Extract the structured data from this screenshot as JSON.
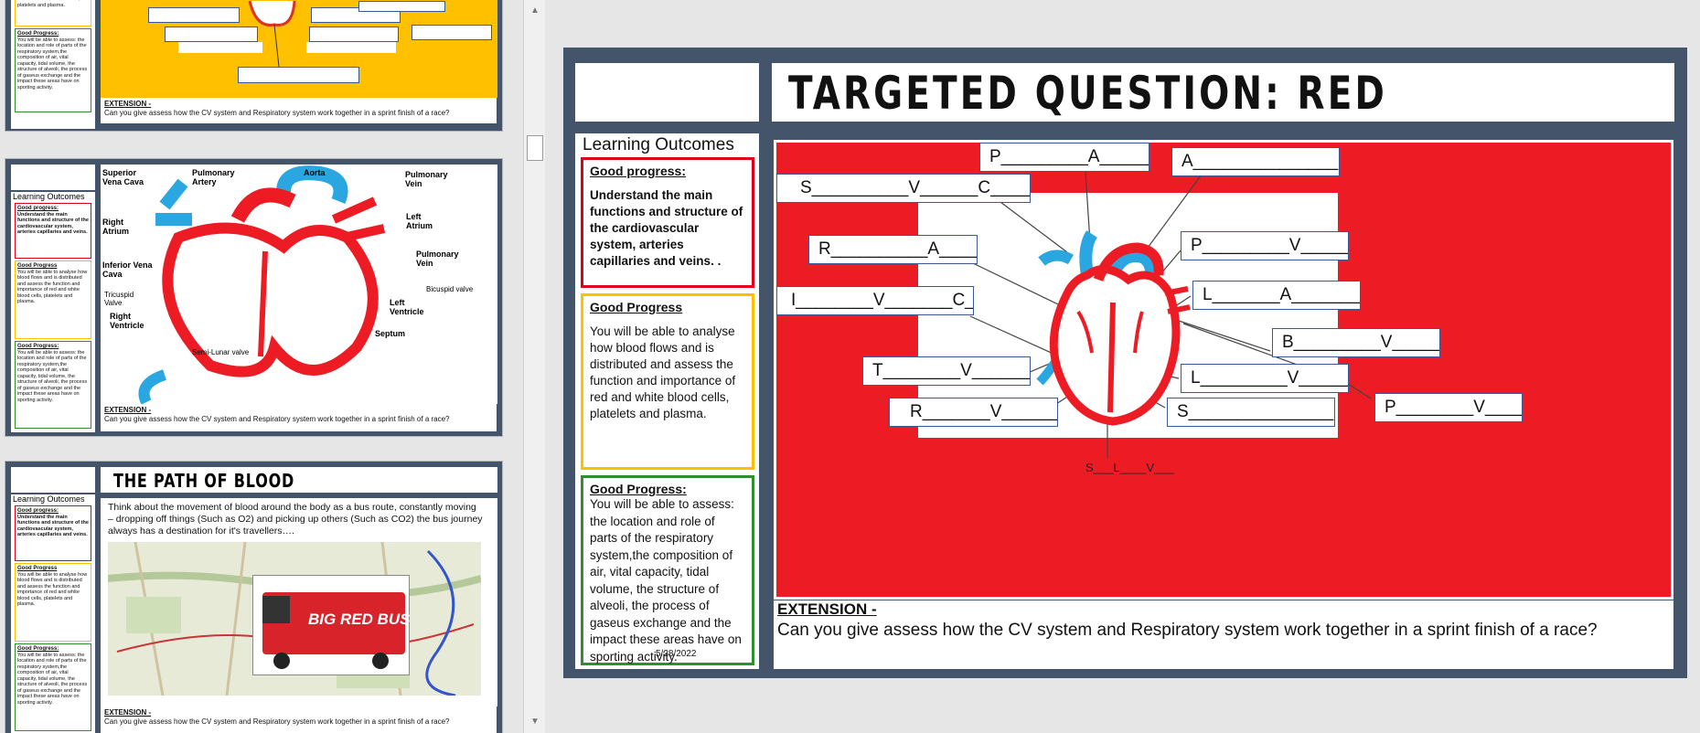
{
  "main_slide": {
    "title": "TARGETED QUESTION: RED",
    "learning_outcomes_title": "Learning Outcomes",
    "outcomes": [
      {
        "heading": "Good progress:",
        "body": "Understand the main functions and structure of the cardiovascular system, arteries capillaries and veins.  ."
      },
      {
        "heading": "Good Progress",
        "body": "You will be able to analyse how blood flows and is distributed and assess the function and importance of red and white blood cells, platelets and plasma."
      },
      {
        "heading": "Good Progress:",
        "body": "You will be able to assess: the location and role of parts of the respiratory system,the composition of air, vital capacity, tidal volume, the structure of alveoli, the process of gaseus exchange and the impact these areas have on sporting activity."
      }
    ],
    "date": "5/28/2022",
    "labels": [
      "P_________A_________",
      "A_______________",
      "S__________V______C_____",
      "R__________A_______",
      "P_________V_________",
      "I________V_______C___",
      "L_______A_________",
      "B_________V________",
      "T________V_________",
      "L_________V__________",
      "R_______V_______",
      "S_______________",
      "P________V______",
      "S___L____V___"
    ],
    "extension_label": "EXTENSION -",
    "extension_text": "Can you give assess how the CV system and Respiratory system work together in a sprint finish of a race?"
  },
  "thumbnails": [
    {
      "extension_label": "EXTENSION -",
      "extension_text": "Can you give assess how the CV system and Respiratory system work together in a sprint finish of a race?",
      "outcome_top": "of red and white blood cells, platelets and plasma.",
      "outcome_green_heading": "Good Progress:",
      "outcome_green_body": "You will be able to assess: the location and role of parts of the respiratory system,the composition of air, vital capacity, tidal volume, the structure of alveoli, the process of gaseus exchange and the impact these areas have on sporting activity."
    },
    {
      "lo_title": "Learning Outcomes",
      "heart_labels": [
        "Superior Vena Cava",
        "Pulmonary Artery",
        "Aorta",
        "Pulmonary Vein",
        "Right Atrium",
        "Left Atrium",
        "Pulmonary Vein",
        "Inferior Vena Cava",
        "Bicuspid valve",
        "Tricuspid Valve",
        "Left Ventricle",
        "Right Ventricle",
        "Septum",
        "Semi-Lunar valve"
      ],
      "extension_label": "EXTENSION -",
      "extension_text": "Can you give assess how the CV system and Respiratory system work together in a sprint finish of a race?"
    },
    {
      "title": "THE PATH OF BLOOD",
      "lo_title": "Learning Outcomes",
      "body": "Think about the movement of blood around the body as a bus route, constantly moving – dropping off things (Such as O2) and picking up others (Such as CO2) the bus journey always has a destination for it's travellers….",
      "bus_text": "BIG RED BUS",
      "extension_label": "EXTENSION -",
      "extension_text": "Can you give assess how the CV system and Respiratory system work together in a sprint finish of a race?"
    }
  ],
  "mini_outcomes": [
    {
      "heading": "Good progress:",
      "body": "Understand the main functions and structure of the cardiovascular system, arteries capillaries and veins."
    },
    {
      "heading": "Good Progress",
      "body": "You will be able to analyse how blood flows and is distributed and assess the function and importance of red and white blood cells, platelets and plasma."
    },
    {
      "heading": "Good Progress:",
      "body": "You will be able to assess: the location and role of parts of the respiratory system,the composition of air, vital capacity, tidal volume, the structure of alveoli, the process of gaseus exchange and the impact these areas have on sporting activity."
    }
  ],
  "colors": {
    "slide_bg": "#44546a",
    "red": "#ed1c24",
    "amber": "#ffc000",
    "green": "#2f8f2f",
    "label_border": "#3a5896"
  },
  "icons": {
    "scroll_up": "triangle-up-icon",
    "scroll_down": "triangle-down-icon"
  }
}
